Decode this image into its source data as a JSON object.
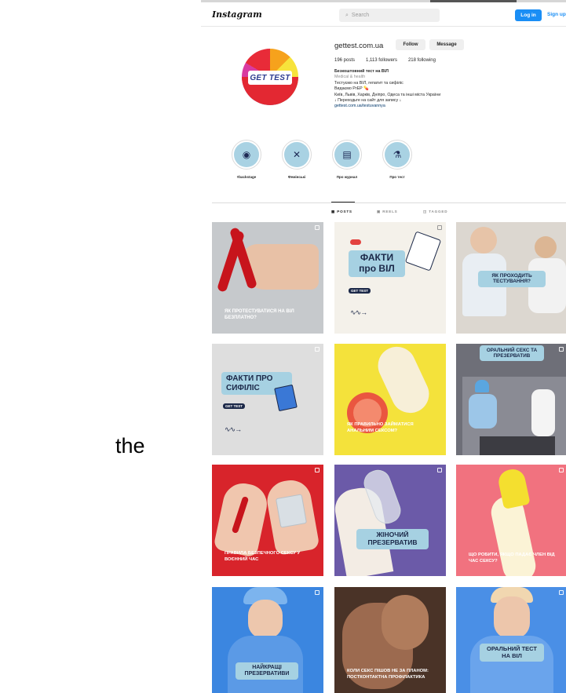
{
  "outside_text": "the",
  "header": {
    "logo": "Instagram",
    "search_placeholder": "Search",
    "login_label": "Log in",
    "signup_label": "Sign up"
  },
  "profile": {
    "avatar_text": "GET TEST",
    "username": "gettest.com.ua",
    "follow_label": "Follow",
    "message_label": "Message",
    "posts": "196 posts",
    "followers": "1,113 followers",
    "following": "218 following",
    "bio_name": "Безкоштовний тест на ВІЛ",
    "bio_category": "Medical & health",
    "bio_lines": [
      "Тестуємо на ВІЛ, гепатит та сифіліс",
      "Видаємо PrEP 💊",
      "Київ, Львів, Харків, Дніпро, Одеса та інші міста України",
      "↓ Переходьте на сайт для запису ↓"
    ],
    "bio_link": "gettest.com.ua/testuvannya"
  },
  "highlights": [
    {
      "label": "#backstage",
      "icon": "gettest-logo-icon"
    },
    {
      "label": "Фемінські",
      "icon": "tools-icon"
    },
    {
      "label": "Про журнал",
      "icon": "book-icon"
    },
    {
      "label": "Про тест",
      "icon": "test-tube-icon"
    }
  ],
  "tabs": {
    "posts": "POSTS",
    "reels": "REELS",
    "tagged": "TAGGED"
  },
  "posts": {
    "p1_caption": "ЯК ПРОТЕСТУВАТИСЯ НА ВІЛ БЕЗПЛАТНО?",
    "p2_title": "ФАКТИ про ВІЛ",
    "p2_brand": "GET TEST",
    "p3_caption": "ЯК ПРОХОДИТЬ ТЕСТУВАННЯ?",
    "p4_title": "ФАКТИ ПРО СИФІЛІС",
    "p4_brand": "GET TEST",
    "p5_caption": "ЯК ПРАВИЛЬНО ЗАЙМАТИСЯ АНАЛЬНИМ СЕКСОМ?",
    "p6_caption": "ОРАЛЬНИЙ СЕКС ТА ПРЕЗЕРВАТИВ",
    "p7_caption": "ПРАВИЛА БЕЗПЕЧНОГО СЕКСУ У ВОЄННИЙ ЧАС",
    "p8_caption": "ЖІНОЧИЙ ПРЕЗЕРВАТИВ",
    "p9_caption": "ЩО РОБИТИ, ЯКЩО ПАДАЄ ЧЛЕН ВІД ЧАС СЕКСУ?",
    "p10_caption": "НАЙКРАЩІ ПРЕЗЕРВАТИВИ",
    "p11_caption": "КОЛИ СЕКС ПІШОВ НЕ ЗА ПЛАНОМ: ПОСТКОНТАКТНА ПРОФІЛАКТИКА",
    "p12_caption": "ОРАЛЬНИЙ ТЕСТ НА ВІЛ"
  },
  "colors": {
    "accent_blue": "#1a8ef5",
    "pill_blue": "#a6d1e2",
    "brand_navy": "#1b2848"
  }
}
